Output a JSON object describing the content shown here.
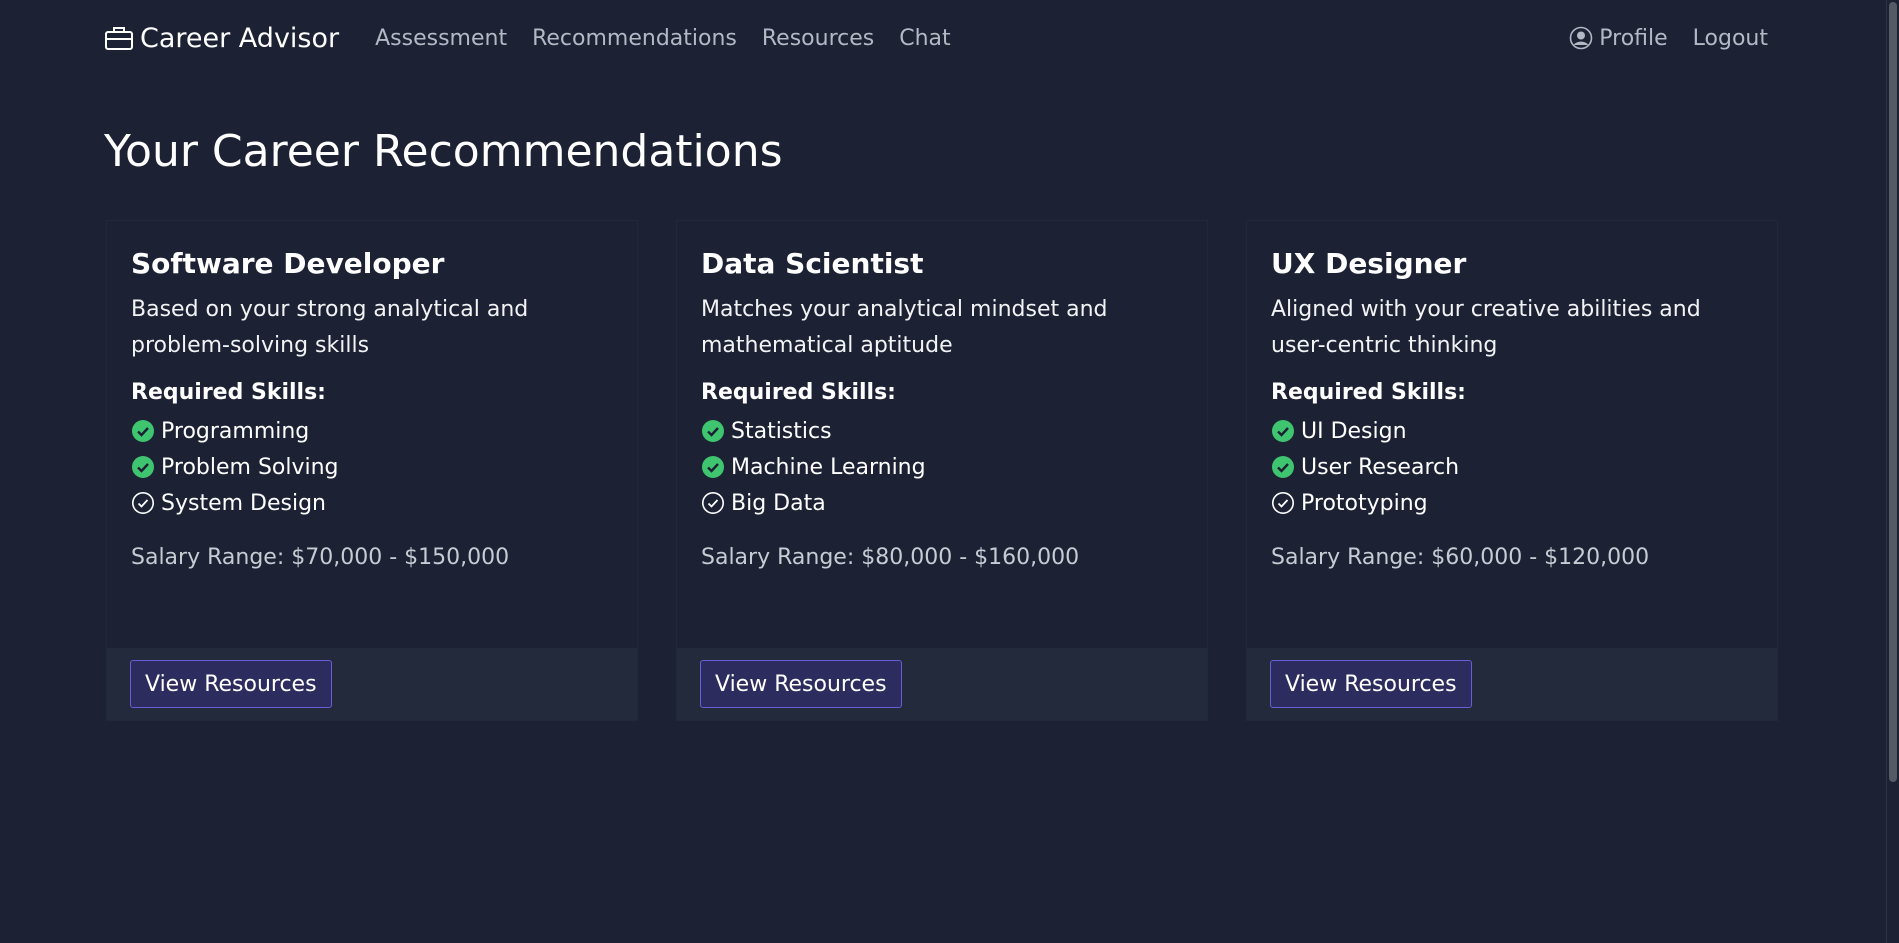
{
  "nav": {
    "brand": "Career Advisor",
    "links": [
      "Assessment",
      "Recommendations",
      "Resources",
      "Chat"
    ],
    "profile": "Profile",
    "logout": "Logout"
  },
  "page": {
    "title": "Your Career Recommendations"
  },
  "cards": [
    {
      "title": "Software Developer",
      "description": "Based on your strong analytical and problem-solving skills",
      "skills_heading": "Required Skills:",
      "skills": [
        {
          "name": "Programming",
          "status": "filled-check-icon"
        },
        {
          "name": "Problem Solving",
          "status": "filled-check-icon"
        },
        {
          "name": "System Design",
          "status": "outline-check-icon"
        }
      ],
      "salary": "Salary Range: $70,000 - $150,000",
      "button": "View Resources"
    },
    {
      "title": "Data Scientist",
      "description": "Matches your analytical mindset and mathematical aptitude",
      "skills_heading": "Required Skills:",
      "skills": [
        {
          "name": "Statistics",
          "status": "filled-check-icon"
        },
        {
          "name": "Machine Learning",
          "status": "filled-check-icon"
        },
        {
          "name": "Big Data",
          "status": "outline-check-icon"
        }
      ],
      "salary": "Salary Range: $80,000 - $160,000",
      "button": "View Resources"
    },
    {
      "title": "UX Designer",
      "description": "Aligned with your creative abilities and user-centric thinking",
      "skills_heading": "Required Skills:",
      "skills": [
        {
          "name": "UI Design",
          "status": "filled-check-icon"
        },
        {
          "name": "User Research",
          "status": "filled-check-icon"
        },
        {
          "name": "Prototyping",
          "status": "outline-check-icon"
        }
      ],
      "salary": "Salary Range: $60,000 - $120,000",
      "button": "View Resources"
    }
  ],
  "colors": {
    "background": "#1c2233",
    "check_green": "#3fc470",
    "button_bg": "#2c2d5e",
    "button_border": "#6a5ed6"
  }
}
